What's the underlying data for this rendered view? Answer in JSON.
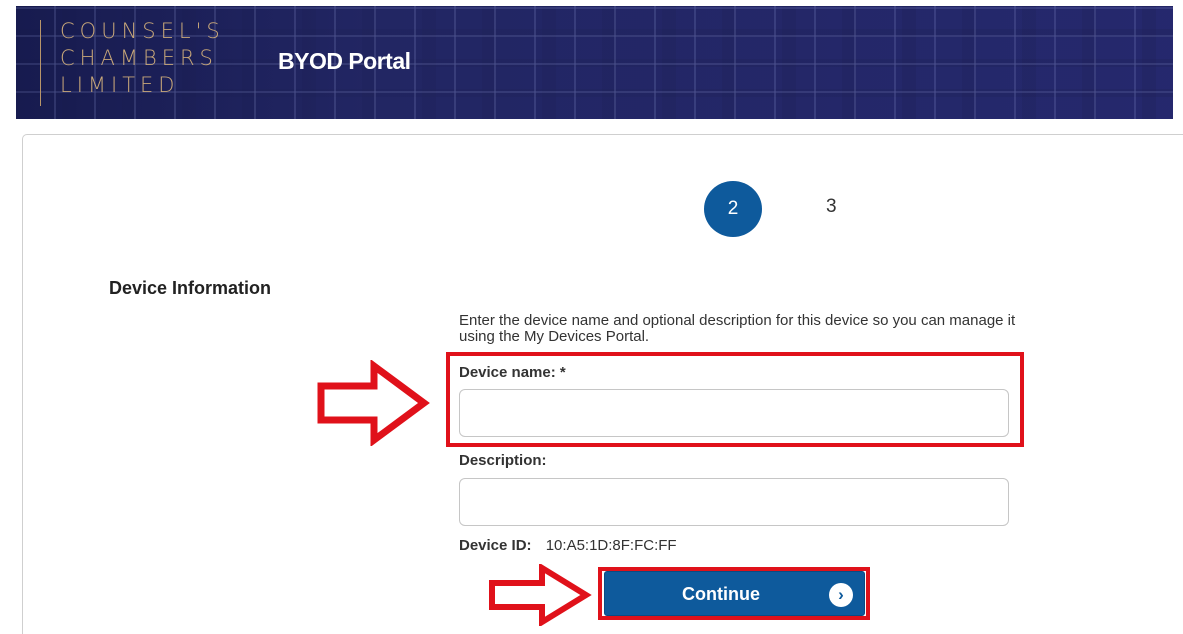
{
  "header": {
    "logo_lines": [
      "COUNSEL'S",
      "CHAMBERS",
      "LIMITED"
    ],
    "title": "BYOD Portal"
  },
  "steps": {
    "current": "2",
    "next": "3"
  },
  "form": {
    "section_heading": "Device Information",
    "intro_text": "Enter the device name and optional description for this device so you can manage it using the My Devices Portal.",
    "device_name_label": "Device name: *",
    "device_name_value": "",
    "description_label": "Description:",
    "description_value": "",
    "device_id_label": "Device ID:",
    "device_id_value": "10:A5:1D:8F:FC:FF",
    "continue_label": "Continue"
  },
  "colors": {
    "primary": "#0e5a9c",
    "annotation": "#e0111a",
    "logo_gold": "#c8a779",
    "banner": "#1f2360"
  },
  "icons": {
    "continue": "chevron-right-icon",
    "annotation": "arrow-right-icon"
  }
}
